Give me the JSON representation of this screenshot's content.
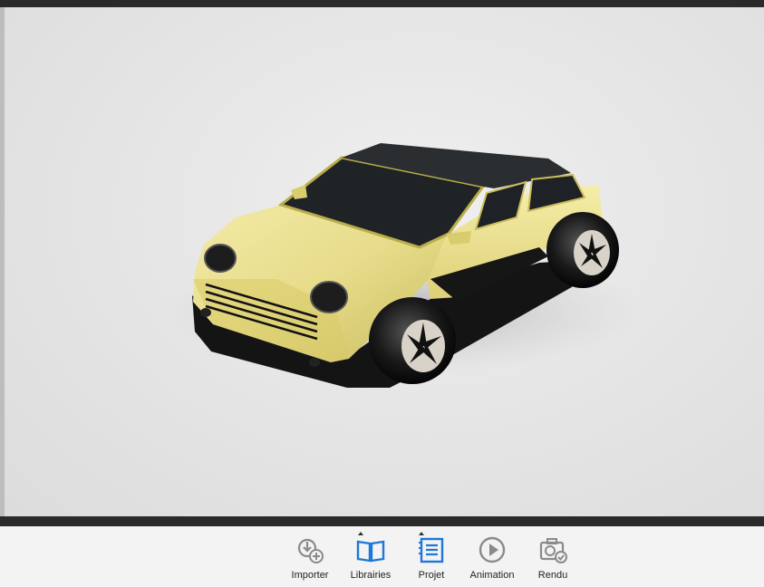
{
  "toolbar": {
    "items": [
      {
        "label": "Importer",
        "icon": "import-icon"
      },
      {
        "label": "Librairies",
        "icon": "library-icon"
      },
      {
        "label": "Projet",
        "icon": "project-icon"
      },
      {
        "label": "Animation",
        "icon": "animation-icon"
      },
      {
        "label": "Rendu",
        "icon": "render-icon"
      }
    ],
    "active_color": "#1e78d7",
    "icon_color": "#8a8a8a"
  },
  "car": {
    "body_color": "#e9df8e",
    "roof_color": "#1c1f22",
    "wheel_color": "#111111"
  }
}
